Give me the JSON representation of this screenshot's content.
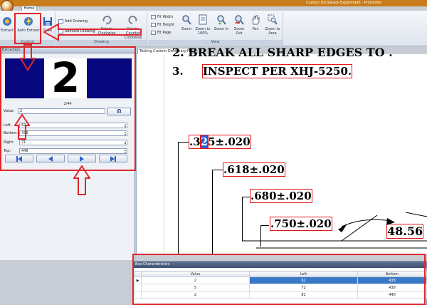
{
  "window": {
    "title": "Custom Dictionary Experiment - ProCenter"
  },
  "tabs": {
    "home": "Home"
  },
  "ribbon": {
    "extract": "Extract",
    "auto_extract": "Auto Extract",
    "save": "Save",
    "add_drawing": "Add Drawing",
    "remove_drawing": "Remove Drawing",
    "rotate_clockwise": "Rotate Clockwise",
    "rotate_counter": "Rotate Counter Clockwise",
    "fit_width": "Fit Width",
    "fit_height": "Fit Height",
    "fit_page": "Fit Page",
    "zoom": "Zoom",
    "zoom_100": "Zoom to 100%",
    "zoom_in": "Zoom In",
    "zoom_out": "Zoom Out",
    "pan": "Pan",
    "zoom_area": "Zoom to Area",
    "group_control": "Control",
    "group_drawing": "Drawing",
    "group_view": "View"
  },
  "extraction": {
    "header": "Extraction",
    "glyph": "2",
    "counter": "2/44",
    "value_label": "Value:",
    "value": "2",
    "omega": "Ω",
    "left_label": "Left:",
    "left": "62",
    "bottom_label": "Bottom:",
    "bottom": "438",
    "right_label": "Right:",
    "right": "71",
    "top_label": "Top:",
    "top": "448"
  },
  "document": {
    "tab": "Testing Custom Dictionary.PDF",
    "line2": "2.    BREAK ALL SHARP EDGES TO .",
    "line3_num": "3.",
    "line3_text": "INSPECT PER XHJ-5250.",
    "dim1_pre": ".3",
    "dim1_sel": "2",
    "dim1_post": "5±.020",
    "dim2": ".618±.020",
    "dim3": ".680±.020",
    "dim4": ".750±.020",
    "dim5": "48.56"
  },
  "grid": {
    "title": "Box Characteristics",
    "columns": [
      "Value",
      "Left",
      "Bottom"
    ],
    "rows": [
      {
        "value": "2",
        "left": "62",
        "bottom": "438"
      },
      {
        "value": "5",
        "left": "72",
        "bottom": "438"
      },
      {
        "value": "±",
        "left": "81",
        "bottom": "440"
      }
    ]
  },
  "colors": {
    "accent": "#e0262a",
    "glyph_bg": "#08087e",
    "selection": "#3a79c8"
  }
}
